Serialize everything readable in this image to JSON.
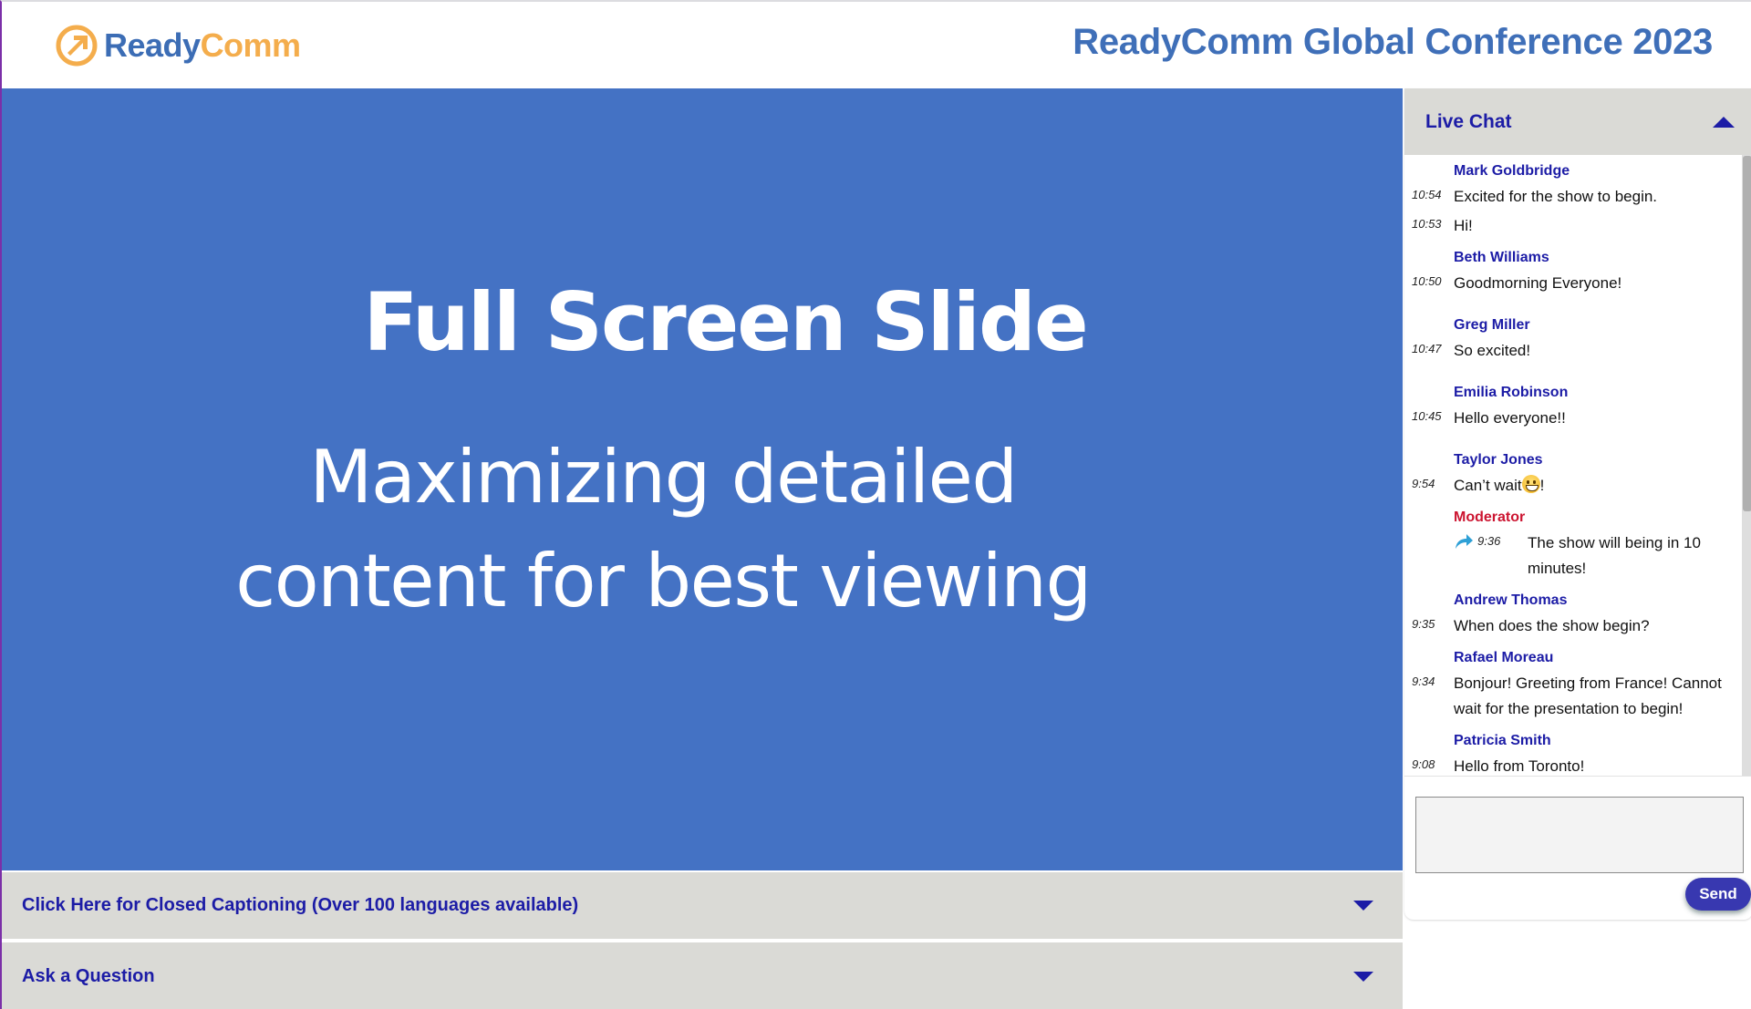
{
  "header": {
    "logo": {
      "part1": "Ready",
      "part2": "Comm",
      "icon": "arrow-circle-icon"
    },
    "event_title": "ReadyComm Global Conference 2023"
  },
  "slide": {
    "title": "Full Screen Slide",
    "subtitle_line1": "Maximizing detailed",
    "subtitle_line2": "content for best viewing",
    "background": "#4472c4"
  },
  "bars": {
    "closed_captioning": "Click Here for Closed Captioning (Over 100 languages available)",
    "ask_question": "Ask a Question"
  },
  "chat": {
    "title": "Live Chat",
    "messages": [
      {
        "sender": "Mark Goldbridge",
        "entries": [
          {
            "time": "10:54",
            "text": "Excited for the show to begin."
          },
          {
            "time": "10:53",
            "text": "Hi!"
          }
        ]
      },
      {
        "sender": "Beth Williams",
        "entries": [
          {
            "time": "10:50",
            "text": "Goodmorning Everyone!"
          }
        ]
      },
      {
        "sender": "Greg Miller",
        "entries": [
          {
            "time": "10:47",
            "text": "So excited!"
          }
        ]
      },
      {
        "sender": "Emilia Robinson",
        "entries": [
          {
            "time": "10:45",
            "text": "Hello everyone!!"
          }
        ]
      },
      {
        "sender": "Taylor Jones",
        "entries": [
          {
            "time": "9:54",
            "text_before": "Can’t wait",
            "emoji": "grinning-face",
            "text_after": "!"
          }
        ]
      },
      {
        "sender": "Moderator",
        "role": "moderator",
        "entries": [
          {
            "time": "9:36",
            "text": "The show will being in 10 minutes!",
            "icon": "share-arrow-icon"
          }
        ]
      },
      {
        "sender": "Andrew Thomas",
        "entries": [
          {
            "time": "9:35",
            "text": "When does the show begin?"
          }
        ]
      },
      {
        "sender": "Rafael Moreau",
        "entries": [
          {
            "time": "9:34",
            "text": "Bonjour! Greeting from France! Cannot wait for the presentation to begin!"
          }
        ]
      },
      {
        "sender": "Patricia Smith",
        "entries": [
          {
            "time": "9:08",
            "text": "Hello from Toronto!"
          }
        ]
      }
    ],
    "input_value": "",
    "input_placeholder": "",
    "send_label": "Send"
  },
  "colors": {
    "accent_blue": "#1c1ca6",
    "moderator_red": "#cc1430",
    "send_button": "#3838b0",
    "logo_blue": "#3c6db5",
    "logo_orange": "#f4ad4c"
  }
}
